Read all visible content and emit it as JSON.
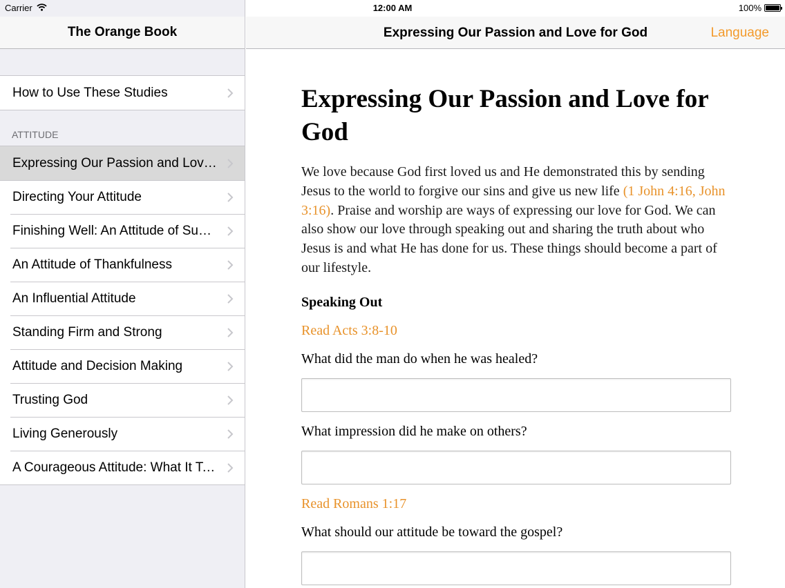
{
  "status_bar": {
    "carrier": "Carrier",
    "time": "12:00 AM",
    "battery": "100%"
  },
  "sidebar": {
    "title": "The Orange Book",
    "top_items": [
      {
        "label": "How to Use These Studies"
      }
    ],
    "section_header": "ATTITUDE",
    "items": [
      {
        "label": "Expressing Our Passion and Love for God",
        "selected": true
      },
      {
        "label": "Directing Your Attitude"
      },
      {
        "label": "Finishing Well: An Attitude of Success"
      },
      {
        "label": "An Attitude of Thankfulness"
      },
      {
        "label": "An Influential Attitude"
      },
      {
        "label": "Standing Firm and Strong"
      },
      {
        "label": "Attitude and Decision Making"
      },
      {
        "label": "Trusting God"
      },
      {
        "label": "Living Generously"
      },
      {
        "label": "A Courageous Attitude: What It Takes"
      }
    ]
  },
  "detail": {
    "nav_title": "Expressing Our Passion and Love for God",
    "language_button": "Language",
    "heading": "Expressing Our Passion and Love for God",
    "intro_before": "We love because God first loved us and He demonstrated this by sending Jesus to the world to forgive our sins and give us new life ",
    "intro_link": "(1 John 4:16, John 3:16)",
    "intro_after": ". Praise and worship are ways of expressing our love for God. We can also show our love through speaking out and sharing the truth about who Jesus is and what He has done for us. These things should become a part of our lifestyle.",
    "section_title": "Speaking Out",
    "reading_1": "Read Acts 3:8-10",
    "question_1": "What did the man do when he was healed?",
    "answer_1": "",
    "question_2": "What impression did he make on others?",
    "answer_2": "",
    "reading_2": "Read Romans 1:17",
    "question_3": "What should our attitude be toward the gospel?",
    "answer_3": ""
  },
  "colors": {
    "accent": "#F39A2B",
    "link": "#E8922A",
    "selected_row": "#D9D9D9",
    "sidebar_bg": "#EFEFF4"
  },
  "icons": [
    "wifi-icon",
    "battery-icon",
    "chevron-right-icon"
  ]
}
